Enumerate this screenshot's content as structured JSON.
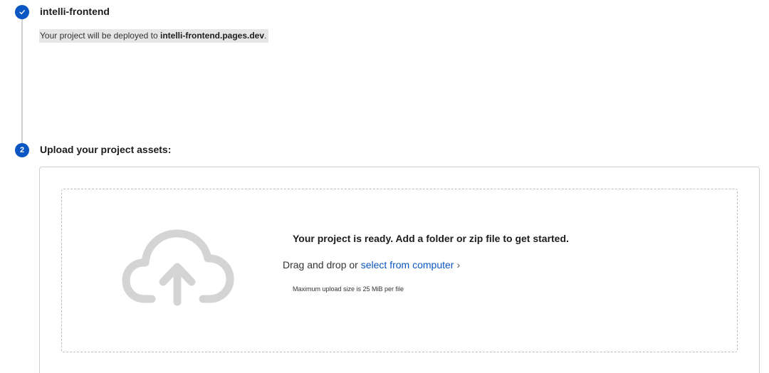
{
  "step1": {
    "title": "intelli-frontend",
    "deploy_prefix": "Your project will be deployed to ",
    "deploy_domain": "intelli-frontend.pages.dev",
    "deploy_suffix": "."
  },
  "step2": {
    "number": "2",
    "title": "Upload your project assets:"
  },
  "upload": {
    "ready_text": "Your project is ready. Add a folder or zip file to get started.",
    "drag_prefix": "Drag and drop or ",
    "select_link": "select from computer",
    "chevron": "›",
    "max_note": "Maximum upload size is 25 MiB per file"
  },
  "colors": {
    "accent": "#0a56c2",
    "cloud": "#d4d4d4"
  }
}
